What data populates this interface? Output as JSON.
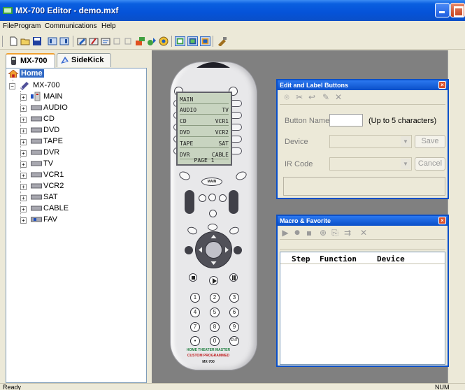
{
  "window": {
    "title": "MX-700 Editor - demo.mxf"
  },
  "menu": {
    "items": [
      "File",
      "Program",
      "Communications",
      "Help"
    ]
  },
  "tabs": [
    {
      "label": "MX-700",
      "icon": "remote-icon"
    },
    {
      "label": "SideKick",
      "icon": "sidekick-icon"
    }
  ],
  "tree": {
    "root": "Home",
    "device": "MX-700",
    "children": [
      "MAIN",
      "AUDIO",
      "CD",
      "DVD",
      "TAPE",
      "DVR",
      "TV",
      "VCR1",
      "VCR2",
      "SAT",
      "CABLE",
      "FAV"
    ]
  },
  "remote": {
    "lcd_rows": [
      {
        "left": "MAIN",
        "right": ""
      },
      {
        "left": "AUDIO",
        "right": "TV"
      },
      {
        "left": "CD",
        "right": "VCR1"
      },
      {
        "left": "DVD",
        "right": "VCR2"
      },
      {
        "left": "TAPE",
        "right": "SAT"
      },
      {
        "left": "DVR",
        "right": "CABLE"
      }
    ],
    "lcd_page": "PAGE 1",
    "main_label": "MAIN",
    "brand_line1": "HOME THEATER MASTER",
    "brand_line2": "CUSTOM PROGRAMMED",
    "brand_line3": "MX-700",
    "numbers": [
      "1",
      "2",
      "3",
      "4",
      "5",
      "6",
      "7",
      "8",
      "9",
      "•",
      "0",
      "ENT"
    ]
  },
  "edit_panel": {
    "title": "Edit and Label Buttons",
    "button_name_label": "Button Name",
    "button_name_hint": "(Up to 5 characters)",
    "device_label": "Device",
    "ir_code_label": "IR Code",
    "save_label": "Save",
    "cancel_label": "Cancel"
  },
  "macro_panel": {
    "title": "Macro & Favorite",
    "columns": [
      "Step",
      "Function",
      "Device"
    ]
  },
  "status": {
    "left": "Ready",
    "right": "NUM"
  }
}
